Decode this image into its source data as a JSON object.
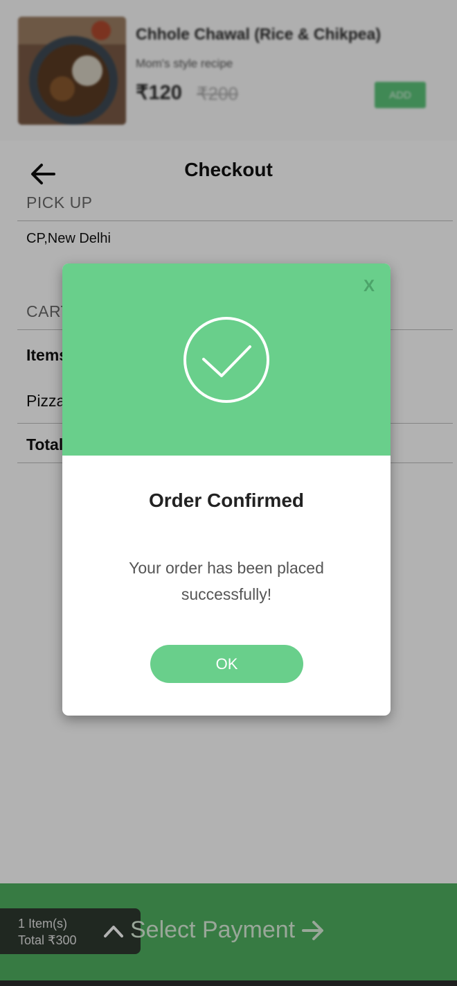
{
  "product": {
    "name": "Chhole Chawal (Rice & Chikpea)",
    "subtitle": "Mom's style recipe",
    "price": "₹120",
    "old_price": "₹200",
    "add_label": "ADD"
  },
  "checkout": {
    "title": "Checkout",
    "pickup_label": "PICK UP",
    "pickup_location": "CP,New Delhi",
    "cart_label": "CART",
    "items_header": "Items",
    "item_name": "Pizza",
    "total_label": "Total"
  },
  "bottom_bar": {
    "items_count": "1 Item(s)",
    "total": "Total ₹300",
    "payment_label": "Select Payment"
  },
  "modal": {
    "close_label": "X",
    "title": "Order Confirmed",
    "message": "Your order has been placed successfully!",
    "ok_label": "OK"
  },
  "colors": {
    "modal_green": "#69cf8b",
    "bar_green": "#4fb060",
    "chip_dark": "#2f3a30"
  },
  "icons": {
    "back": "arrow-left-icon",
    "check": "check-circle-icon",
    "close": "close-icon",
    "caret": "chevron-up-icon",
    "forward": "arrow-right-icon"
  }
}
